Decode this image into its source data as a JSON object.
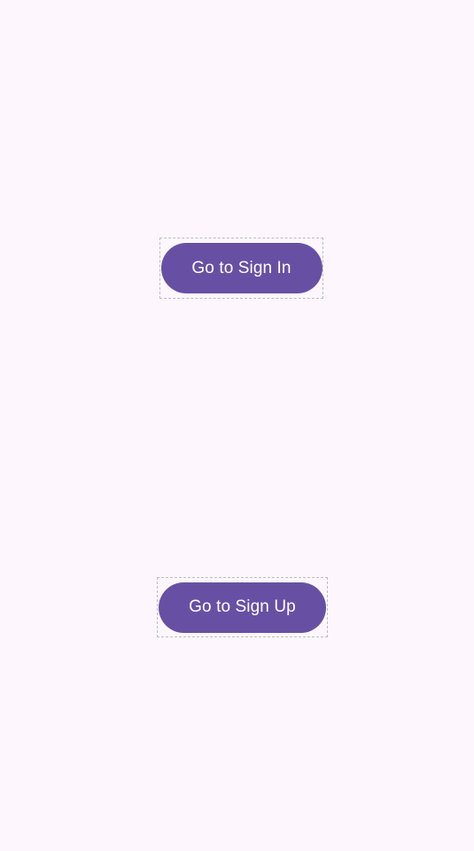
{
  "buttons": {
    "sign_in_label": "Go to Sign In",
    "sign_up_label": "Go to Sign Up"
  },
  "colors": {
    "background": "#fdf7fd",
    "button": "#6750a4",
    "button_text": "#ffffff"
  }
}
